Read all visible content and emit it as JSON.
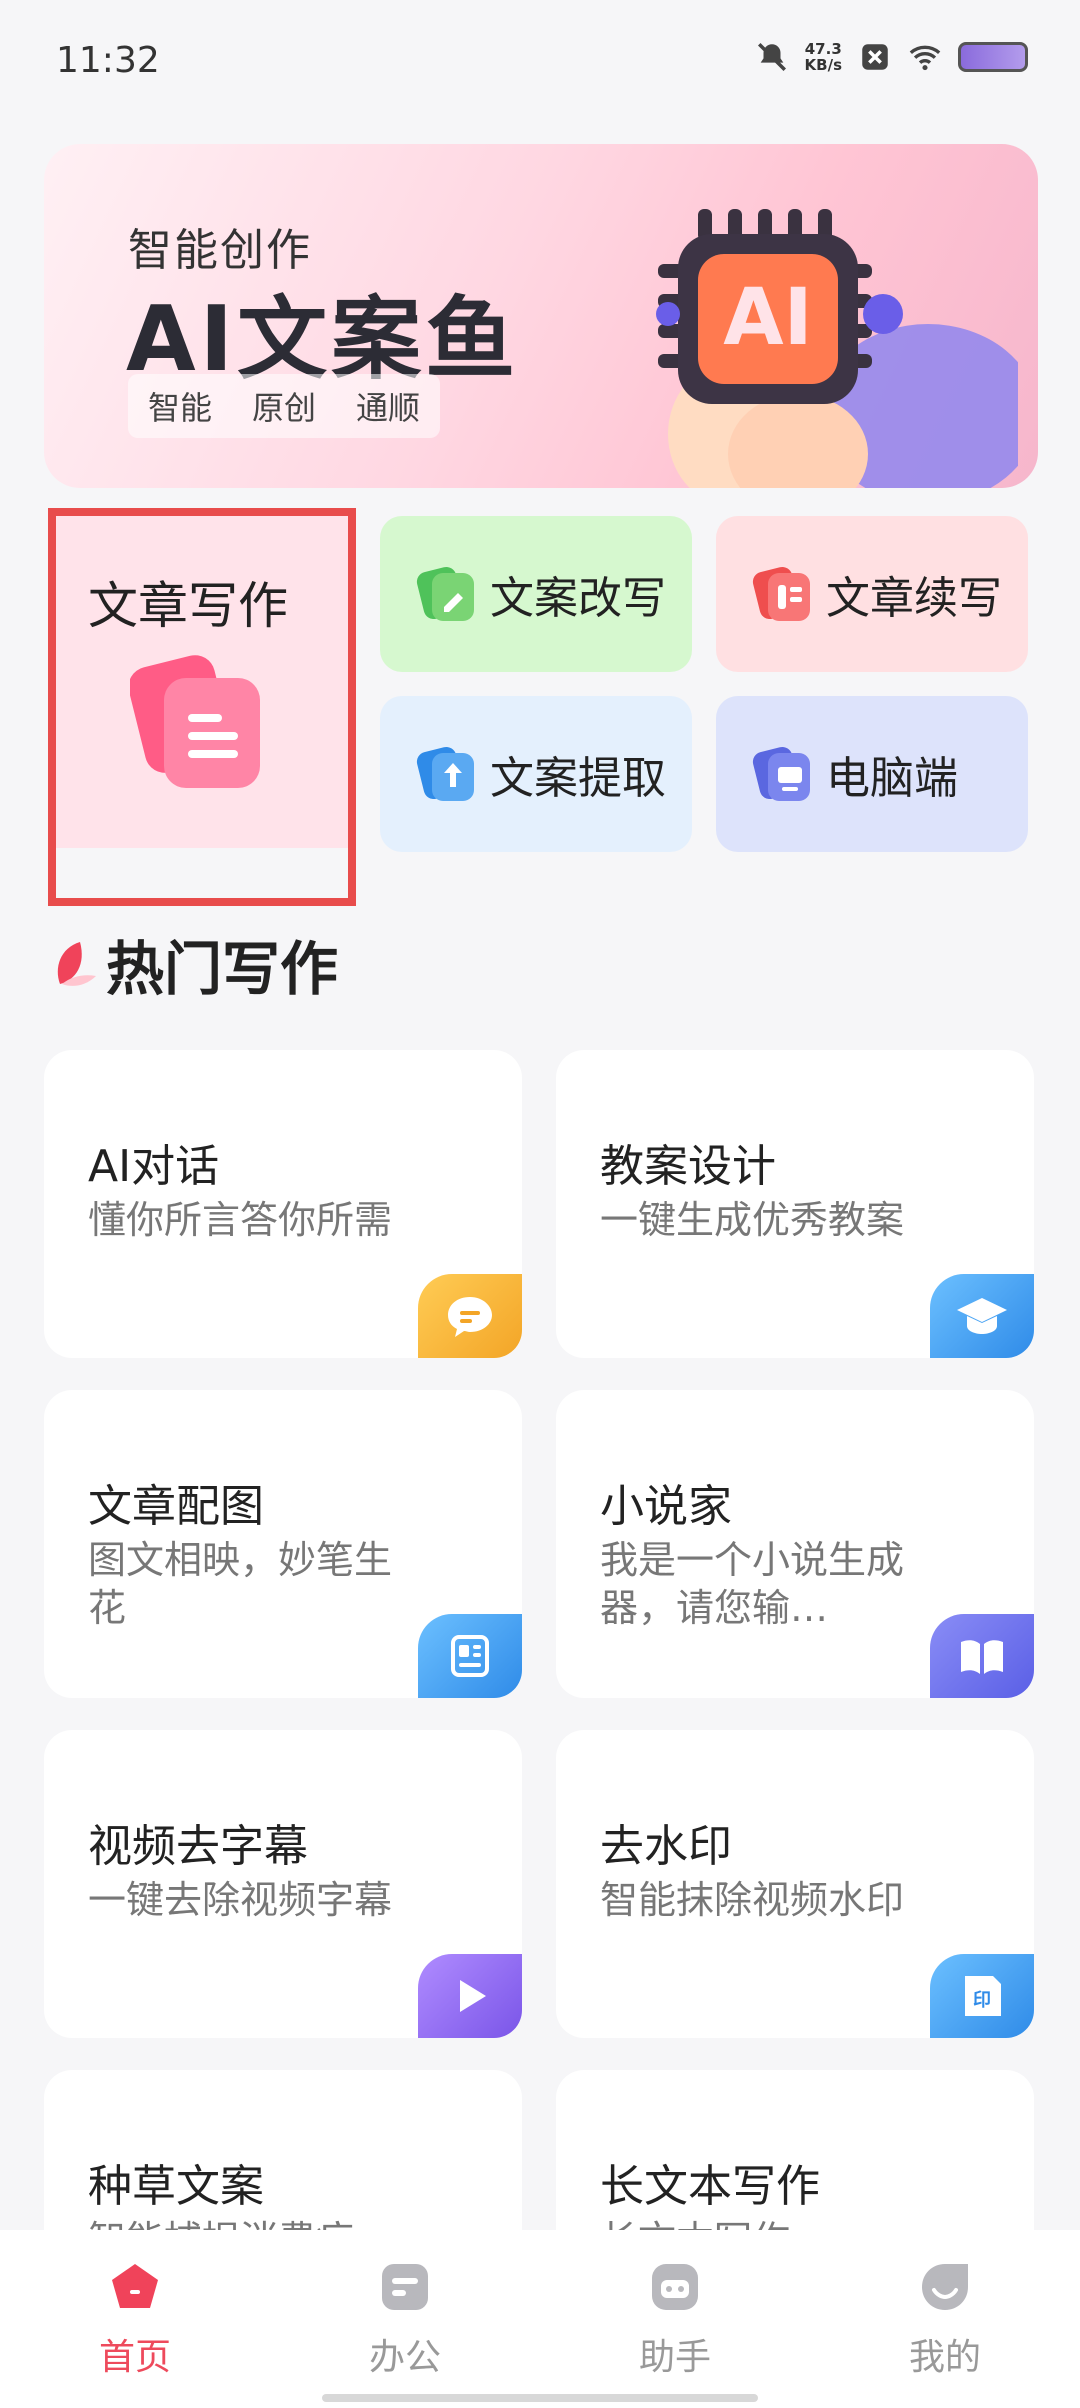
{
  "status_bar": {
    "time": "11:32",
    "net_speed_value": "47.3",
    "net_speed_unit": "KB/s",
    "icons": [
      "mute-bell-icon",
      "x-box-icon",
      "wifi-icon",
      "battery-icon"
    ]
  },
  "banner": {
    "subtitle": "智能创作",
    "title": "AI文案鱼",
    "tags": [
      "智能",
      "原创",
      "通顺"
    ],
    "chip_text": "AI"
  },
  "quick": {
    "article_writing": "文章写作",
    "rewrite": "文案改写",
    "continue": "文章续写",
    "extract": "文案提取",
    "desktop": "电脑端"
  },
  "section": {
    "title": "热门写作"
  },
  "cards": [
    {
      "title": "AI对话",
      "desc": "懂你所言答你所需",
      "icon": "chat-bubble-icon"
    },
    {
      "title": "教案设计",
      "desc": "一键生成优秀教案",
      "icon": "graduation-cap-icon"
    },
    {
      "title": "文章配图",
      "desc": "图文相映，妙笔生花",
      "icon": "image-text-icon"
    },
    {
      "title": "小说家",
      "desc": "我是一个小说生成器，请您输…",
      "icon": "book-icon"
    },
    {
      "title": "视频去字幕",
      "desc": "一键去除视频字幕",
      "icon": "play-icon"
    },
    {
      "title": "去水印",
      "desc": "智能抹除视频水印",
      "icon": "stamp-icon"
    },
    {
      "title": "种草文案",
      "desc": "智能捕捉消费痕",
      "icon": ""
    },
    {
      "title": "长文本写作",
      "desc": "长文本写作",
      "icon": ""
    }
  ],
  "nav": {
    "items": [
      {
        "label": "首页",
        "active": true
      },
      {
        "label": "办公",
        "active": false
      },
      {
        "label": "助手",
        "active": false
      },
      {
        "label": "我的",
        "active": false
      }
    ]
  },
  "colors": {
    "accent": "#ee4a5c",
    "highlight_border": "#e84c4c"
  }
}
